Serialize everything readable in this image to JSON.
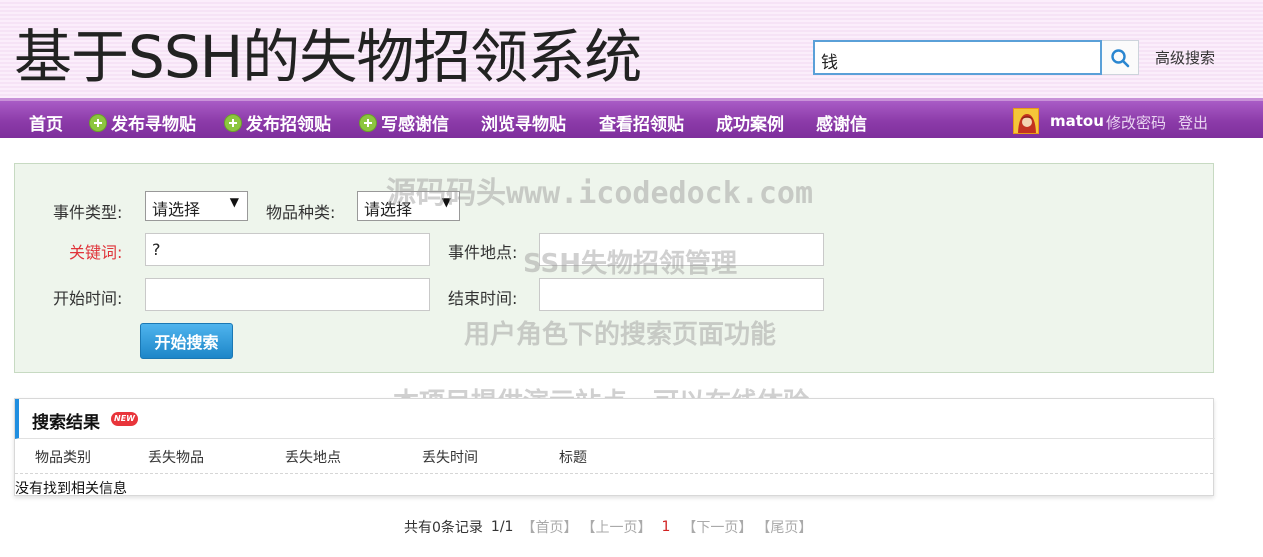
{
  "header": {
    "site_title": "基于SSH的失物招领系统",
    "search_value": "钱",
    "advanced_search": "高级搜索"
  },
  "nav": {
    "items": [
      {
        "label": "首页",
        "icon": null
      },
      {
        "label": "发布寻物贴",
        "icon": "plus-circle-icon"
      },
      {
        "label": "发布招领贴",
        "icon": "plus-circle-icon"
      },
      {
        "label": "写感谢信",
        "icon": "plus-circle-icon"
      },
      {
        "label": "浏览寻物贴",
        "icon": null
      },
      {
        "label": "查看招领贴",
        "icon": null
      },
      {
        "label": "成功案例",
        "icon": null
      },
      {
        "label": "感谢信",
        "icon": null
      }
    ],
    "username": "matou",
    "change_password": "修改密码",
    "logout": "登出"
  },
  "form": {
    "event_type_label": "事件类型:",
    "event_type_value": "请选择",
    "item_kind_label": "物品种类:",
    "item_kind_value": "请选择",
    "keyword_label": "关键词:",
    "keyword_value": "?",
    "location_label": "事件地点:",
    "location_value": "",
    "start_time_label": "开始时间:",
    "start_time_value": "",
    "end_time_label": "结束时间:",
    "end_time_value": "",
    "search_button": "开始搜索"
  },
  "watermark": {
    "line1": "源码码头www.icodedock.com",
    "line2": "SSH失物招领管理",
    "line3": "用户角色下的搜索页面功能",
    "line4": "本项目提供演示站点，可以在线体验。"
  },
  "results": {
    "title": "搜索结果",
    "badge": "NEW",
    "columns": [
      "物品类别",
      "丢失物品",
      "丢失地点",
      "丢失时间",
      "标题"
    ],
    "empty_message": "没有找到相关信息"
  },
  "pager": {
    "total": "共有0条记录",
    "page_info": "1/1",
    "first": "【首页】",
    "prev": "【上一页】",
    "current": "1",
    "next": "【下一页】",
    "last": "【尾页】"
  },
  "colors": {
    "nav_bg": "#8c3ba9",
    "accent_blue": "#1f8ee0",
    "form_bg": "#eef5ec",
    "keyword_label": "#e0343a",
    "plus_icon": "#8dc63f"
  }
}
